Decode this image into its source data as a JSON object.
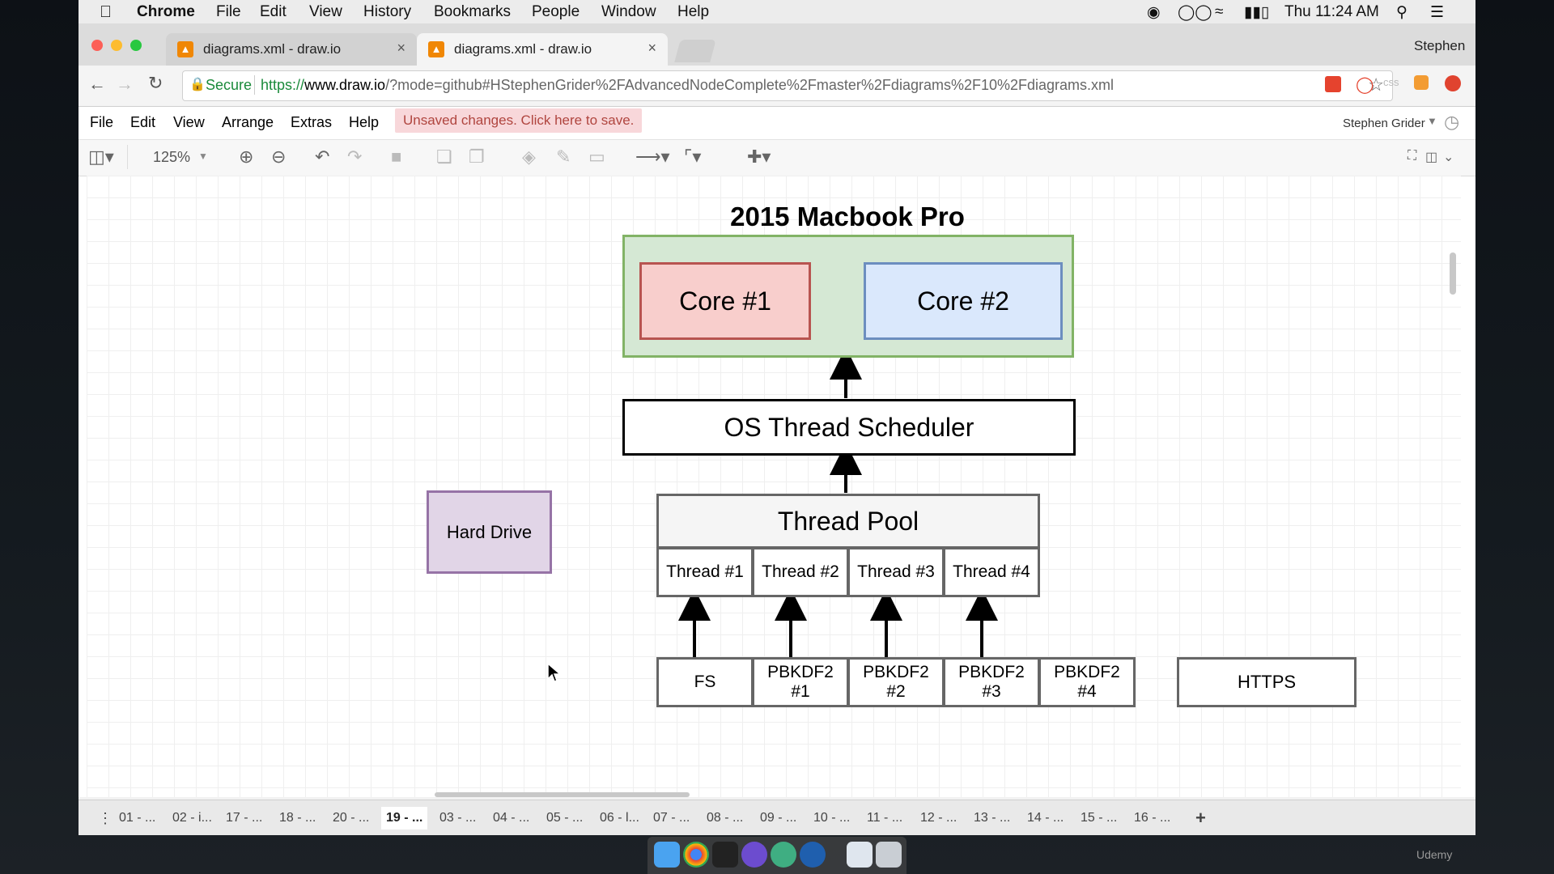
{
  "menubar": {
    "app": "Chrome",
    "items": [
      "File",
      "Edit",
      "View",
      "History",
      "Bookmarks",
      "People",
      "Window",
      "Help"
    ],
    "clock": "Thu 11:24 AM"
  },
  "browser": {
    "tabs": [
      {
        "title": "diagrams.xml - draw.io",
        "active": false
      },
      {
        "title": "diagrams.xml - draw.io",
        "active": true
      }
    ],
    "profile": "Stephen",
    "secure_label": "Secure",
    "url_prefix": "https://",
    "url_host": "www.draw.io",
    "url_rest": "/?mode=github#HStephenGrider%2FAdvancedNodeComplete%2Fmaster%2Fdiagrams%2F10%2Fdiagrams.xml"
  },
  "drawio": {
    "menu": [
      "File",
      "Edit",
      "View",
      "Arrange",
      "Extras",
      "Help"
    ],
    "unsaved": "Unsaved changes. Click here to save.",
    "user": "Stephen Grider",
    "zoom": "125%"
  },
  "diagram": {
    "title": "2015 Macbook Pro",
    "core1": "Core #1",
    "core2": "Core #2",
    "scheduler": "OS Thread Scheduler",
    "pool": "Thread Pool",
    "threads": [
      "Thread #1",
      "Thread #2",
      "Thread #3",
      "Thread #4"
    ],
    "tasks": [
      "FS",
      "PBKDF2 #1",
      "PBKDF2 #2",
      "PBKDF2 #3",
      "PBKDF2 #4"
    ],
    "hard_drive": "Hard Drive",
    "https": "HTTPS"
  },
  "pages": [
    "01 - ...",
    "02 - i...",
    "17 - ...",
    "18 - ...",
    "20 - ...",
    "19 - ...",
    "03 - ...",
    "04 - ...",
    "05 - ...",
    "06 - l...",
    "07 - ...",
    "08 - ...",
    "09 - ...",
    "10 - ...",
    "11 - ...",
    "12 - ...",
    "13 - ...",
    "14 - ...",
    "15 - ...",
    "16 - ..."
  ],
  "active_page": "19 - ...",
  "watermark": "Udemy",
  "colors": {
    "macbook_fill": "#d5e8d4",
    "macbook_border": "#82b366",
    "core1_fill": "#f8cecc",
    "core1_border": "#b85450",
    "core2_fill": "#dae8fc",
    "core2_border": "#6c8ebf",
    "harddrive_fill": "#e1d5e7",
    "harddrive_border": "#9673a6",
    "unsaved_bg": "#f8d7da",
    "unsaved_text": "#b0453f"
  }
}
